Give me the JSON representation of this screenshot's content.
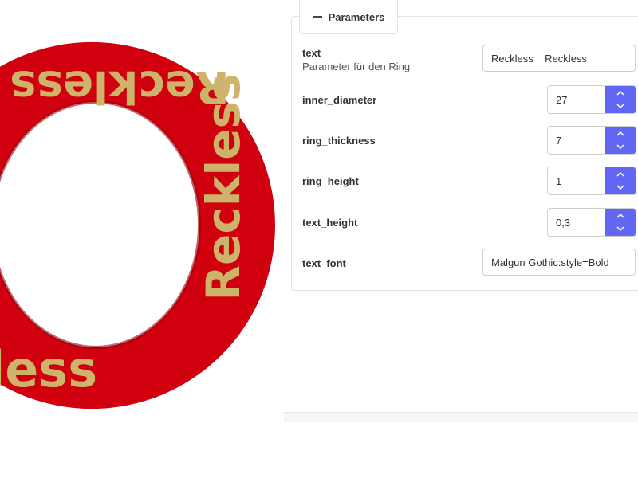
{
  "preview": {
    "ring_text": "Reckless",
    "ring_color": "#d0000e",
    "text_color": "#cdb46a"
  },
  "parameters": {
    "tab_label": "Parameters",
    "fields": [
      {
        "name": "text",
        "description": "Parameter für den Ring",
        "value": "Reckless    Reckless",
        "kind": "text"
      },
      {
        "name": "inner_diameter",
        "value": "27",
        "kind": "number"
      },
      {
        "name": "ring_thickness",
        "value": "7",
        "kind": "number"
      },
      {
        "name": "ring_height",
        "value": "1",
        "kind": "number"
      },
      {
        "name": "text_height",
        "value": "0,3",
        "kind": "number"
      },
      {
        "name": "text_font",
        "value": "Malgun Gothic:style=Bold",
        "kind": "text"
      }
    ]
  },
  "colors": {
    "spinner_accent": "#6167f2"
  }
}
